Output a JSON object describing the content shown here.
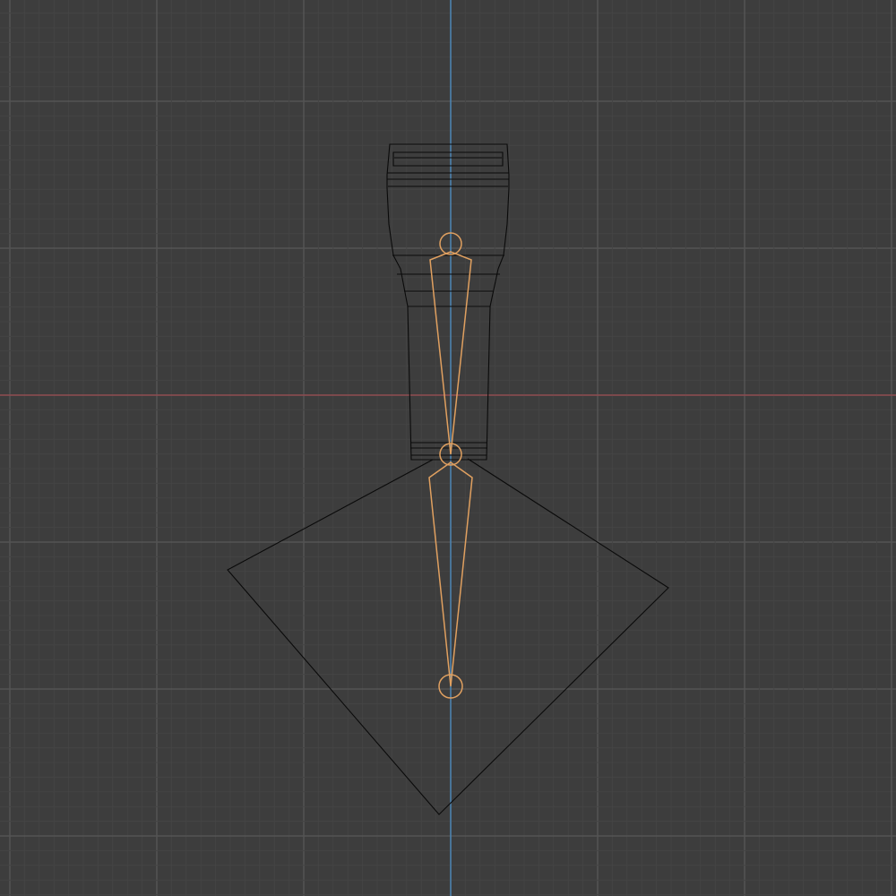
{
  "viewport": {
    "view": "3d-viewport-front-orthographic",
    "colors": {
      "background": "#3d3d3d",
      "grid_minor": "#444444",
      "grid_major": "#545454",
      "axis_x": "#9b4a4f",
      "axis_z": "#4a8dc4",
      "wireframe": "#0a0a0a",
      "bone": "#e0a060"
    },
    "objects": [
      {
        "name": "flashlight-mesh",
        "type": "mesh"
      },
      {
        "name": "plane-mesh",
        "type": "mesh"
      },
      {
        "name": "armature",
        "type": "armature",
        "bones": 2
      }
    ]
  }
}
